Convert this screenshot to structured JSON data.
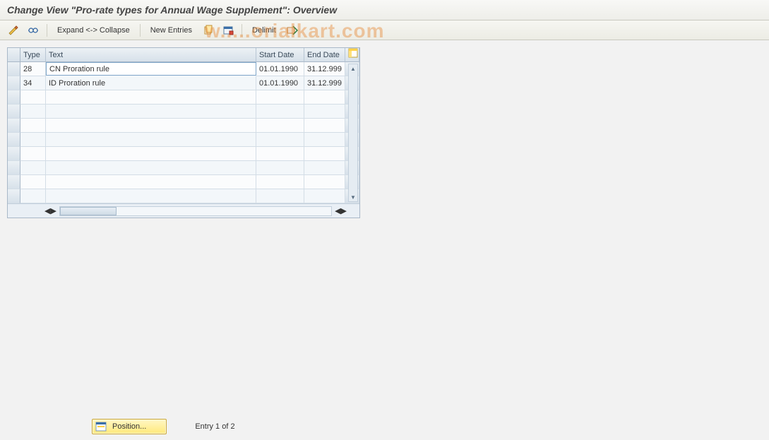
{
  "header": {
    "title": "Change View \"Pro-rate types for Annual Wage Supplement\": Overview"
  },
  "toolbar": {
    "expand_collapse": "Expand <-> Collapse",
    "new_entries": "New Entries",
    "delimit": "Delimit",
    "icons": {
      "toggle": "toggle-edit-icon",
      "glasses": "details-icon",
      "copy": "copy-icon",
      "delete": "delete-icon",
      "delimit": "delimit-icon"
    }
  },
  "grid": {
    "columns": {
      "type": "Type",
      "text": "Text",
      "start": "Start Date",
      "end": "End Date"
    },
    "rows": [
      {
        "type": "28",
        "text": "CN Proration rule",
        "start": "01.01.1990",
        "end": "31.12.999"
      },
      {
        "type": "34",
        "text": "ID Proration rule",
        "start": "01.01.1990",
        "end": "31.12.999"
      }
    ],
    "empty_rows": 8
  },
  "footer": {
    "position_label": "Position...",
    "entry_status": "Entry 1 of 2"
  },
  "watermark": "w.....orialkart.com"
}
